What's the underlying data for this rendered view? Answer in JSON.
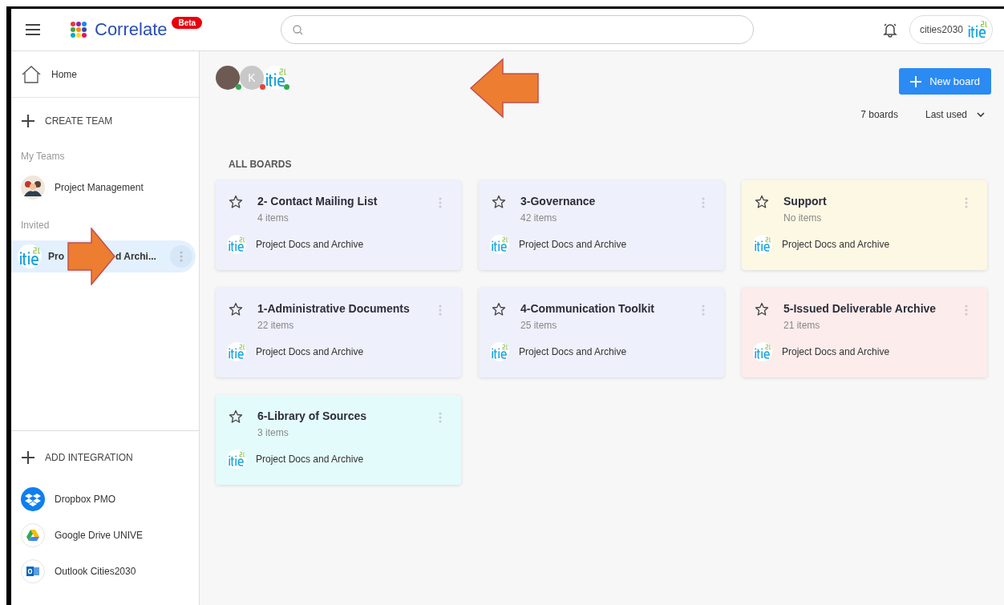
{
  "header": {
    "brand": "Correlate",
    "badge": "Beta",
    "account": "cities2030"
  },
  "sidebar": {
    "home": "Home",
    "create_team": "CREATE TEAM",
    "sections": [
      {
        "title": "My Teams",
        "teams": [
          {
            "kind": "group",
            "label_parts": [
              "Project Management"
            ],
            "selected": false
          }
        ]
      },
      {
        "title": "Invited",
        "teams": [
          {
            "kind": "logo",
            "label_parts": [
              "Pro",
              "d Archi..."
            ],
            "selected": true
          }
        ]
      }
    ],
    "add_integration": "ADD INTEGRATION",
    "integrations": [
      {
        "kind": "dropbox",
        "label": "Dropbox PMO"
      },
      {
        "kind": "drive",
        "label": "Google Drive UNIVE"
      },
      {
        "kind": "outlook",
        "label": "Outlook Cities2030"
      }
    ]
  },
  "main": {
    "members": [
      {
        "kind": "photo",
        "color": "#34a853"
      },
      {
        "kind": "letter",
        "letter": "K",
        "color": "#ea4335"
      },
      {
        "kind": "logo",
        "color": "#34a853"
      }
    ],
    "new_board": "New board",
    "count": "7 boards",
    "sort": "Last used",
    "section_title": "ALL BOARDS",
    "boards": [
      {
        "title": "2- Contact Mailing List",
        "items": "4 items",
        "team": "Project Docs and Archive",
        "color": "#eef0fb"
      },
      {
        "title": "3-Governance",
        "items": "42 items",
        "team": "Project Docs and Archive",
        "color": "#eef0fb"
      },
      {
        "title": "Support",
        "items": "No items",
        "team": "Project Docs and Archive",
        "color": "#fdf8e4"
      },
      {
        "title": "1-Administrative Documents",
        "items": "22 items",
        "team": "Project Docs and Archive",
        "color": "#eef0fb"
      },
      {
        "title": "4-Communication Toolkit",
        "items": "25 items",
        "team": "Project Docs and Archive",
        "color": "#eef0fb"
      },
      {
        "title": "5-Issued Deliverable Archive",
        "items": "21 items",
        "team": "Project Docs and Archive",
        "color": "#fdecec"
      },
      {
        "title": "6-Library of Sources",
        "items": "3 items",
        "team": "Project Docs and Archive",
        "color": "#e4fbfb"
      }
    ]
  }
}
